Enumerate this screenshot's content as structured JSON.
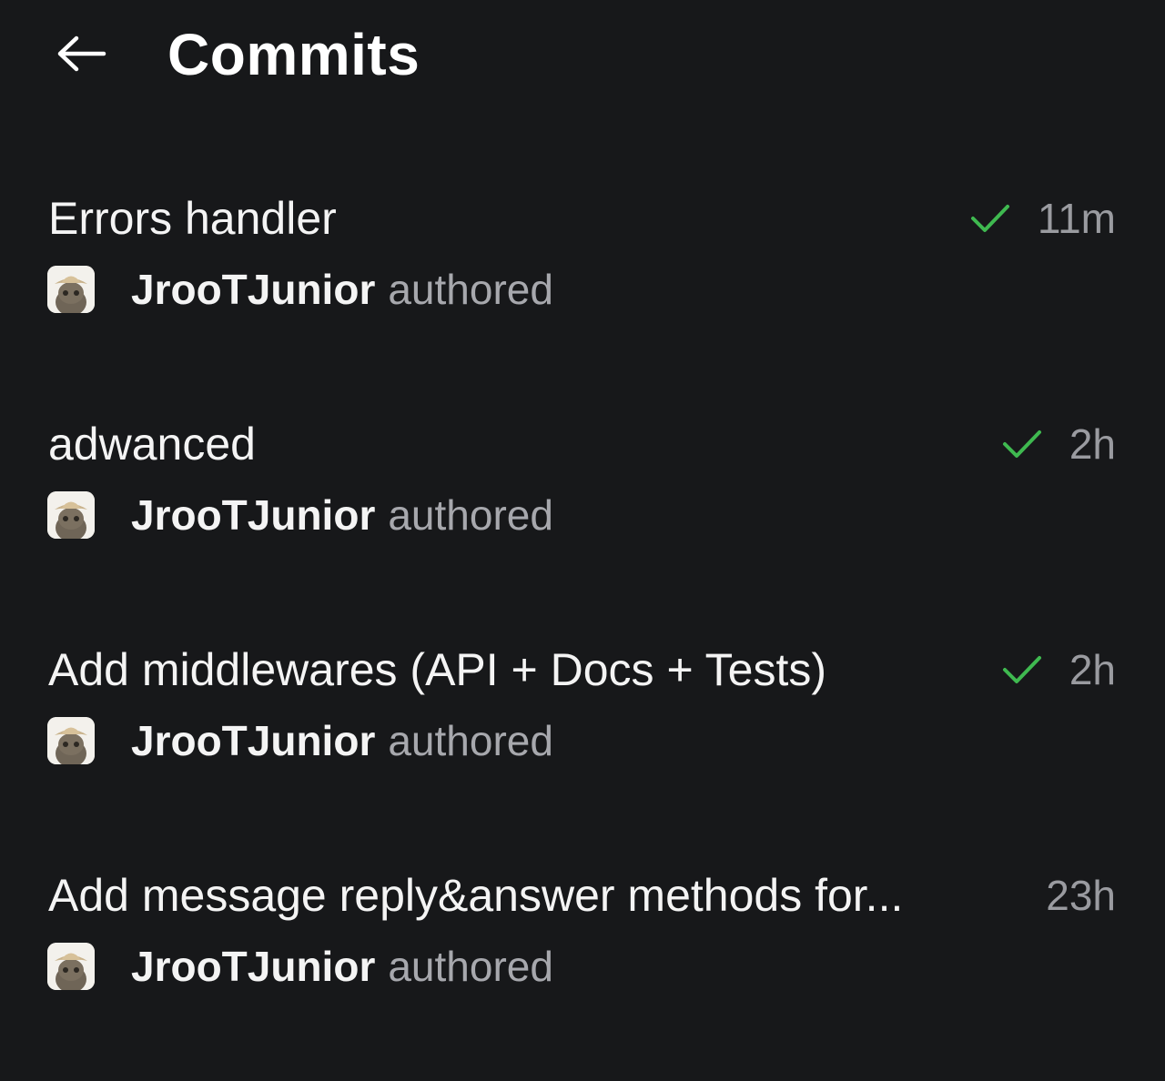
{
  "header": {
    "title": "Commits",
    "back_icon": "arrow-left-icon"
  },
  "colors": {
    "background": "#17181a",
    "text": "#f4f4f4",
    "muted": "#9a9ba0",
    "success": "#3fb950"
  },
  "commits": [
    {
      "message": "Errors handler",
      "status_icon": "check-icon",
      "time": "11m",
      "author": "JrooTJunior",
      "action": "authored"
    },
    {
      "message": "adwanced",
      "status_icon": "check-icon",
      "time": "2h",
      "author": "JrooTJunior",
      "action": "authored"
    },
    {
      "message": "Add middlewares (API + Docs + Tests)",
      "status_icon": "check-icon",
      "time": "2h",
      "author": "JrooTJunior",
      "action": "authored"
    },
    {
      "message": "Add message reply&answer methods for...",
      "status_icon": "",
      "time": "23h",
      "author": "JrooTJunior",
      "action": "authored"
    }
  ]
}
